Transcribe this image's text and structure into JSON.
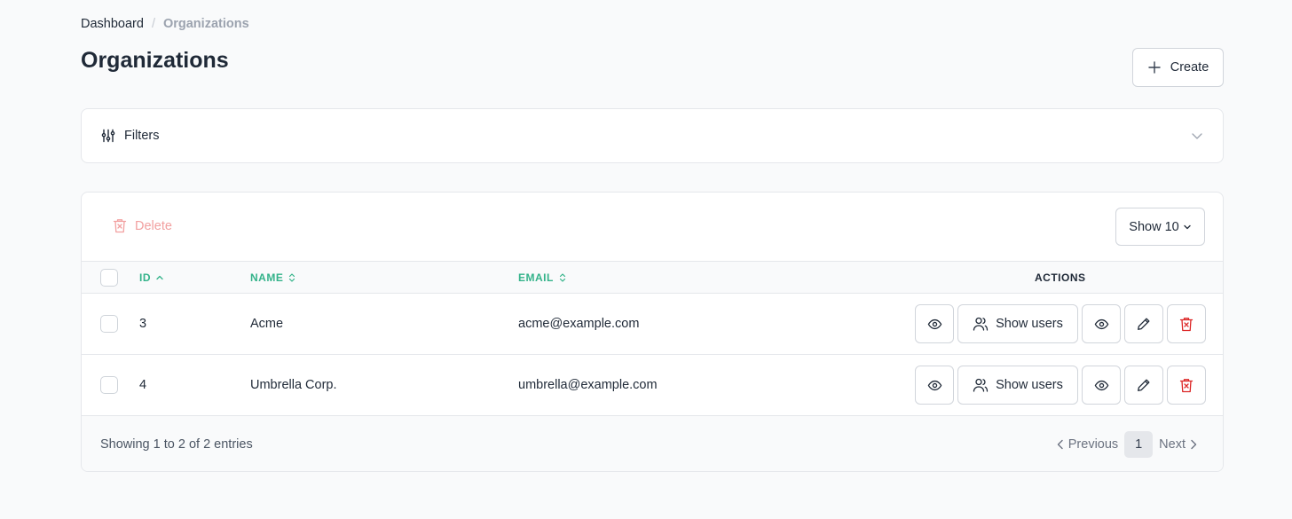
{
  "breadcrumb": {
    "parent": "Dashboard",
    "separator": "/",
    "current": "Organizations"
  },
  "page": {
    "title": "Organizations",
    "create_label": "Create"
  },
  "filters": {
    "label": "Filters"
  },
  "toolbar": {
    "delete_label": "Delete",
    "page_size_label": "Show 10"
  },
  "table": {
    "columns": {
      "id": "ID",
      "name": "NAME",
      "email": "EMAIL",
      "actions": "ACTIONS"
    },
    "rows": [
      {
        "id": "3",
        "name": "Acme",
        "email": "acme@example.com",
        "show_users_label": "Show users"
      },
      {
        "id": "4",
        "name": "Umbrella Corp.",
        "email": "umbrella@example.com",
        "show_users_label": "Show users"
      }
    ]
  },
  "pagination": {
    "summary": "Showing 1 to 2 of 2 entries",
    "previous_label": "Previous",
    "current_page": "1",
    "next_label": "Next"
  },
  "colors": {
    "accent_green": "#34b38a",
    "danger_red": "#dc2626",
    "danger_disabled": "#f2a0a0"
  }
}
